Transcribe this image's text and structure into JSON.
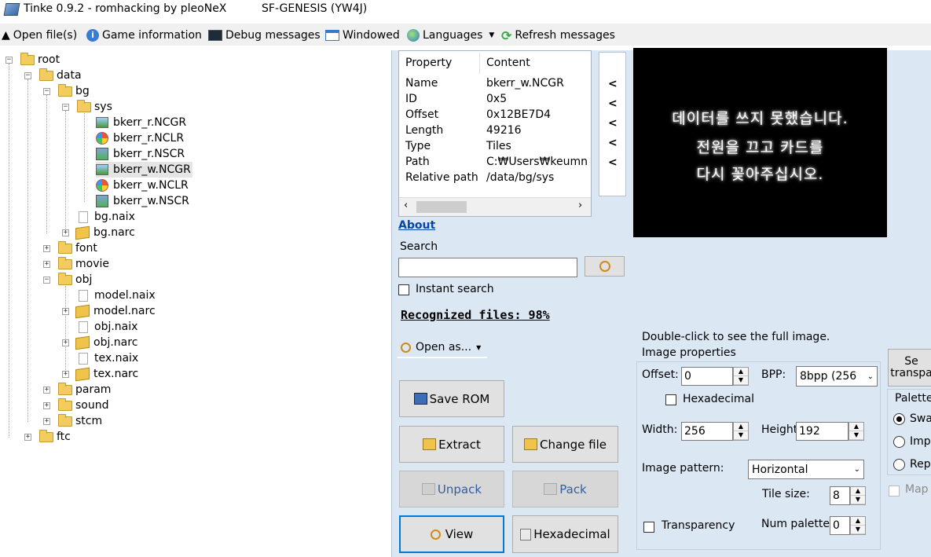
{
  "window": {
    "title": "Tinke 0.9.2 - romhacking by pleoNeX",
    "game": "SF-GENESIS (YW4J)"
  },
  "menu": {
    "open_files": "Open file(s)",
    "game_info": "Game information",
    "debug": "Debug messages",
    "windowed": "Windowed",
    "languages": "Languages",
    "refresh": "Refresh messages"
  },
  "tree": {
    "root": "root",
    "data": "data",
    "bg": "bg",
    "sys": "sys",
    "f1": "bkerr_r.NCGR",
    "f2": "bkerr_r.NCLR",
    "f3": "bkerr_r.NSCR",
    "f4": "bkerr_w.NCGR",
    "f5": "bkerr_w.NCLR",
    "f6": "bkerr_w.NSCR",
    "bg_naix": "bg.naix",
    "bg_narc": "bg.narc",
    "font": "font",
    "movie": "movie",
    "obj": "obj",
    "model_naix": "model.naix",
    "model_narc": "model.narc",
    "obj_naix": "obj.naix",
    "obj_narc": "obj.narc",
    "tex_naix": "tex.naix",
    "tex_narc": "tex.narc",
    "param": "param",
    "sound": "sound",
    "stcm": "stcm",
    "ftc": "ftc"
  },
  "properties": {
    "col_property": "Property",
    "col_content": "Content",
    "rows": [
      {
        "k": "Name",
        "v": "bkerr_w.NCGR"
      },
      {
        "k": "ID",
        "v": "0x5"
      },
      {
        "k": "Offset",
        "v": "0x12BE7D4"
      },
      {
        "k": "Length",
        "v": "49216"
      },
      {
        "k": "Type",
        "v": "Tiles"
      },
      {
        "k": "Path",
        "v": "C:₩Users₩keumn"
      },
      {
        "k": "Relative path",
        "v": "/data/bg/sys"
      }
    ]
  },
  "side_arrow": "<",
  "preview_text": {
    "l1": "데이터를 쓰지 못했습니다.",
    "l2": "전원을 끄고 카드를",
    "l3": "다시 꽂아주십시오."
  },
  "about": "About",
  "search": {
    "label": "Search",
    "value": "",
    "instant": "Instant search"
  },
  "recognized": "Recognized files: 98%",
  "open_as": "Open as...",
  "buttons": {
    "save_rom": "Save ROM",
    "extract": "Extract",
    "change_file": "Change file",
    "unpack": "Unpack",
    "pack": "Pack",
    "view": "View",
    "hexadecimal": "Hexadecimal"
  },
  "image": {
    "hint": "Double-click to see the full image.",
    "group": "Image properties",
    "offset_label": "Offset:",
    "offset": "0",
    "bpp_label": "BPP:",
    "bpp": "8bpp (256",
    "hex_label": "Hexadecimal",
    "width_label": "Width:",
    "width": "256",
    "height_label": "Height",
    "height": "192",
    "pattern_label": "Image pattern:",
    "pattern": "Horizontal",
    "tile_label": "Tile size:",
    "tile": "8",
    "transparency": "Transparency",
    "numpal_label": "Num palette",
    "numpal": "0"
  },
  "right_cut": {
    "set_l1": "Se",
    "set_l2": "transpa",
    "palette": "Palette",
    "r1": "Swa",
    "r2": "Imp",
    "r3": "Rep",
    "map": "Map"
  }
}
